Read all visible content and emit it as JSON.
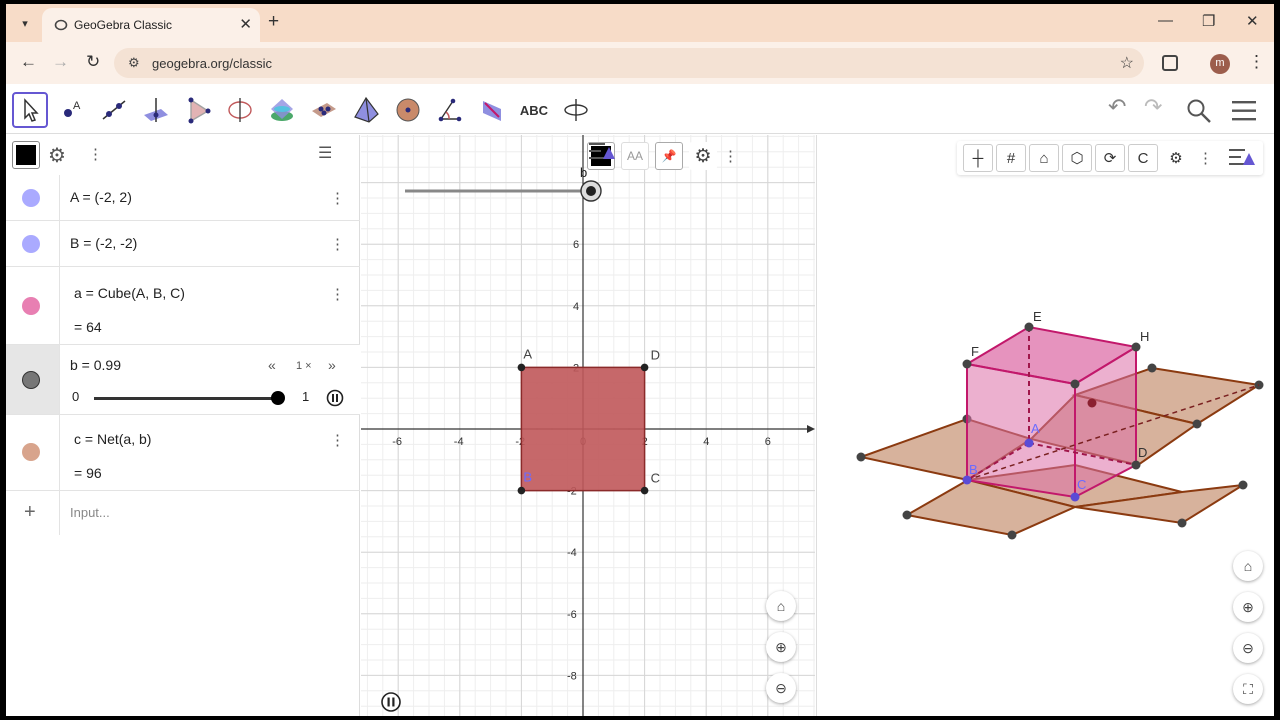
{
  "browser": {
    "tab_title": "GeoGebra Classic",
    "url": "geogebra.org/classic",
    "avatar_letter": "m"
  },
  "toolbar": {
    "text_tool_label": "ABC"
  },
  "algebra": {
    "rows": [
      {
        "expr": "A = (-2, 2)",
        "color": "#aaaaff"
      },
      {
        "expr": "B = (-2, -2)",
        "color": "#aaaaff"
      },
      {
        "expr": "a = Cube(A, B, C)",
        "value": "= 64",
        "color": "#e87fb2"
      },
      {
        "expr": "b = 0.99",
        "speed": "1 ×",
        "slider_min": "0",
        "slider_max": "1",
        "slider_value": 0.99,
        "color": "#777777"
      },
      {
        "expr": "c = Net(a, b)",
        "value": "= 96",
        "color": "#d8a48c"
      }
    ],
    "input_placeholder": "Input..."
  },
  "graphics2d": {
    "slider_label": "b",
    "x_ticks": [
      "-6",
      "-4",
      "-2",
      "0",
      "2",
      "4",
      "6"
    ],
    "y_ticks": [
      "6",
      "4",
      "2",
      "-2",
      "-4",
      "-6",
      "-8"
    ],
    "point_labels": [
      "A",
      "B",
      "C",
      "D"
    ],
    "style_label": "AA"
  },
  "graphics3d": {
    "labels": [
      "E",
      "F",
      "H",
      "A",
      "B",
      "C",
      "D"
    ]
  },
  "colors": {
    "square_fill": "#c0585a",
    "net_fill": "#d2a78e",
    "net_stroke": "#8b3a10",
    "cube_fill": "#dd6fa8",
    "cube_stroke": "#c2186b"
  }
}
